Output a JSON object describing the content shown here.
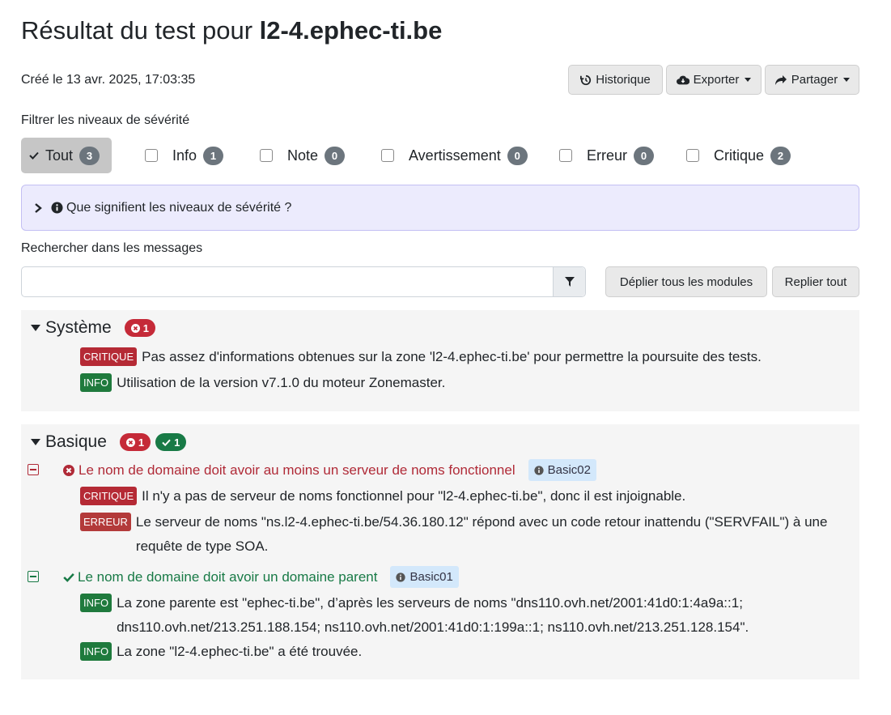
{
  "header": {
    "title_prefix": "Résultat du test pour ",
    "domain": "l2-4.ephec-ti.be",
    "created": "Créé le 13 avr. 2025, 17:03:35"
  },
  "actions": {
    "history": "Historique",
    "export": "Exporter",
    "share": "Partager"
  },
  "filters": {
    "label": "Filtrer les niveaux de sévérité",
    "items": [
      {
        "label": "Tout",
        "count": "3"
      },
      {
        "label": "Info",
        "count": "1"
      },
      {
        "label": "Note",
        "count": "0"
      },
      {
        "label": "Avertissement",
        "count": "0"
      },
      {
        "label": "Erreur",
        "count": "0"
      },
      {
        "label": "Critique",
        "count": "2"
      }
    ]
  },
  "severity_help": "Que signifient les niveaux de sévérité ?",
  "search": {
    "label": "Rechercher dans les messages",
    "value": "",
    "expand_all": "Déplier tous les modules",
    "collapse_all": "Replier tout"
  },
  "modules": [
    {
      "name": "Système",
      "badges": [
        "1"
      ],
      "messages": [
        {
          "level": "CRITIQUE",
          "text": "Pas assez d'informations obtenues sur la zone 'l2-4.ephec-ti.be' pour permettre la poursuite des tests."
        },
        {
          "level": "INFO",
          "text": "Utilisation de la version v7.1.0 du moteur Zonemaster."
        }
      ]
    },
    {
      "name": "Basique",
      "badges": [
        "1",
        "1"
      ],
      "tests": [
        {
          "title": "Le nom de domaine doit avoir au moins un serveur de noms fonctionnel",
          "code": "Basic02",
          "messages": [
            {
              "level": "CRITIQUE",
              "text": "Il n'y a pas de serveur de noms fonctionnel pour \"l2-4.ephec-ti.be\", donc il est injoignable."
            },
            {
              "level": "ERREUR",
              "text": "Le serveur de noms \"ns.l2-4.ephec-ti.be/54.36.180.12\" répond avec un code retour inattendu (\"SERVFAIL\") à une requête de type SOA."
            }
          ]
        },
        {
          "title": "Le nom de domaine doit avoir un domaine parent",
          "code": "Basic01",
          "messages": [
            {
              "level": "INFO",
              "text": "La zone parente est \"ephec-ti.be\", d’après les serveurs de noms \"dns110.ovh.net/2001:41d0:1:4a9a::1; dns110.ovh.net/213.251.188.154; ns110.ovh.net/2001:41d0:1:199a::1; ns110.ovh.net/213.251.128.154\"."
            },
            {
              "level": "INFO",
              "text": "La zone \"l2-4.ephec-ti.be\" a été trouvée."
            }
          ]
        }
      ]
    }
  ]
}
